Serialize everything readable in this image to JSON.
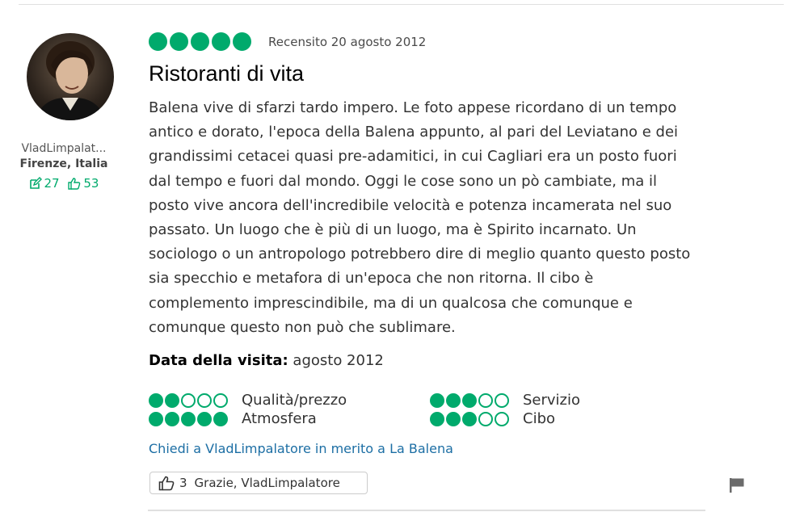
{
  "reviewer": {
    "name": "VladLimpalat...",
    "location": "Firenze, Italia",
    "reviews_count": "27",
    "helpful_votes": "53",
    "review_icon": "pencil-note-icon",
    "votes_icon": "thumbs-up-icon"
  },
  "review": {
    "rating": 5,
    "date": "Recensito 20 agosto 2012",
    "title": "Ristoranti di vita",
    "body": "Balena vive di sfarzi tardo impero. Le foto appese ricordano di un tempo antico e dorato, l'epoca della Balena appunto, al pari del Leviatano e dei grandissimi cetacei quasi pre-adamitici, in cui Cagliari era un posto fuori dal tempo e fuori dal mondo. Oggi le cose sono un pò cambiate, ma il posto vive ancora dell'incredibile velocità e potenza incamerata nel suo passato. Un luogo che è più di un luogo, ma è Spirito incarnato. Un sociologo o un antropologo potrebbero dire di meglio quanto questo posto sia specchio e metafora di un'epoca che non ritorna. Il cibo è complemento imprescindibile, ma di un qualcosa che comunque e comunque questo non può che sublimare.",
    "visit_label": "Data della visita:",
    "visit_date": "agosto 2012"
  },
  "subratings": [
    {
      "label": "Qualità/prezzo",
      "value": 2
    },
    {
      "label": "Servizio",
      "value": 3
    },
    {
      "label": "Atmosfera",
      "value": 5
    },
    {
      "label": "Cibo",
      "value": 3
    }
  ],
  "ask_link": "Chiedi a VladLimpalatore in merito a La Balena",
  "thanks": {
    "count": "3",
    "label": "Grazie, VladLimpalatore"
  },
  "colors": {
    "bubble": "#00aa6c",
    "link": "#1c6ea4"
  }
}
